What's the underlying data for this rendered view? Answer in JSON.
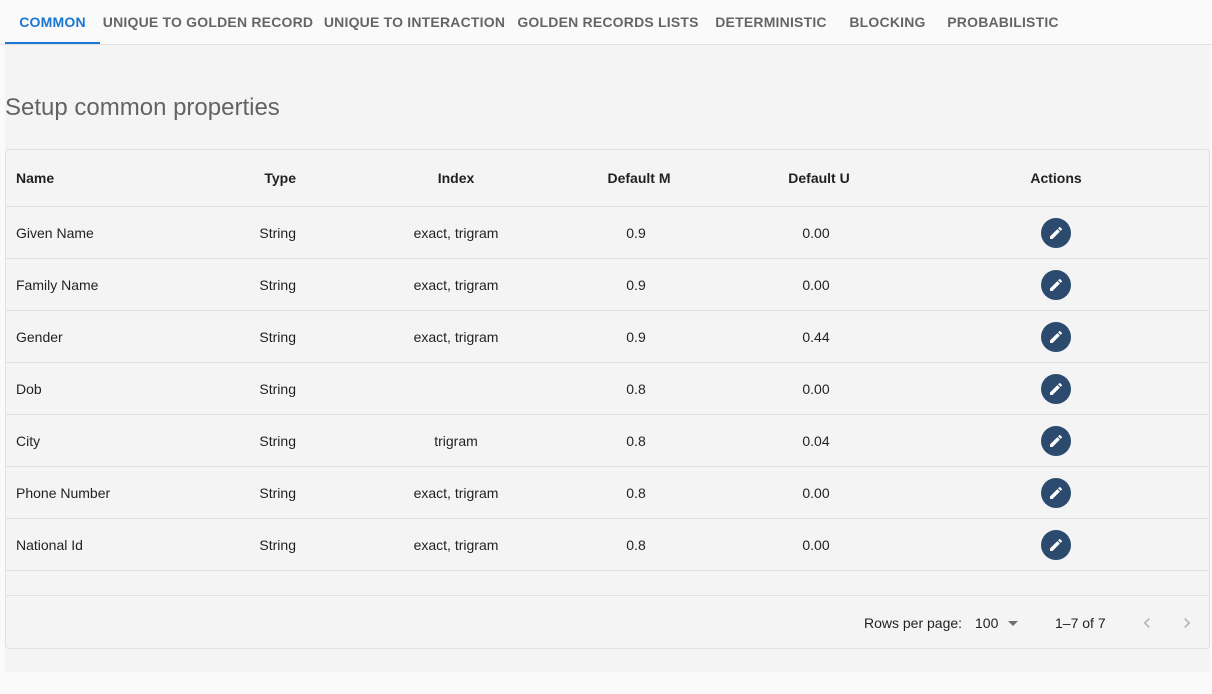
{
  "tabs": [
    {
      "label": "Common"
    },
    {
      "label": "Unique to Golden Record"
    },
    {
      "label": "Unique to Interaction"
    },
    {
      "label": "Golden Records Lists"
    },
    {
      "label": "Deterministic"
    },
    {
      "label": "Blocking"
    },
    {
      "label": "Probabilistic"
    }
  ],
  "active_tab": "Common",
  "page_title": "Setup common properties",
  "table": {
    "columns": [
      "Name",
      "Type",
      "Index",
      "Default M",
      "Default U",
      "Actions"
    ],
    "rows": [
      {
        "name": "Given Name",
        "type": "String",
        "index": "exact, trigram",
        "default_m": "0.9",
        "default_u": "0.00"
      },
      {
        "name": "Family Name",
        "type": "String",
        "index": "exact, trigram",
        "default_m": "0.9",
        "default_u": "0.00"
      },
      {
        "name": "Gender",
        "type": "String",
        "index": "exact, trigram",
        "default_m": "0.9",
        "default_u": "0.44"
      },
      {
        "name": "Dob",
        "type": "String",
        "index": "",
        "default_m": "0.8",
        "default_u": "0.00"
      },
      {
        "name": "City",
        "type": "String",
        "index": "trigram",
        "default_m": "0.8",
        "default_u": "0.04"
      },
      {
        "name": "Phone Number",
        "type": "String",
        "index": "exact, trigram",
        "default_m": "0.8",
        "default_u": "0.00"
      },
      {
        "name": "National Id",
        "type": "String",
        "index": "exact, trigram",
        "default_m": "0.8",
        "default_u": "0.00"
      }
    ],
    "action_icon": "edit-icon"
  },
  "pagination": {
    "rows_per_page_label": "Rows per page:",
    "rows_per_page_value": "100",
    "range_label": "1–7 of 7"
  },
  "colors": {
    "accent": "#1976d2",
    "edit_button": "#2c4a6e",
    "background": "#f4f4f4"
  }
}
